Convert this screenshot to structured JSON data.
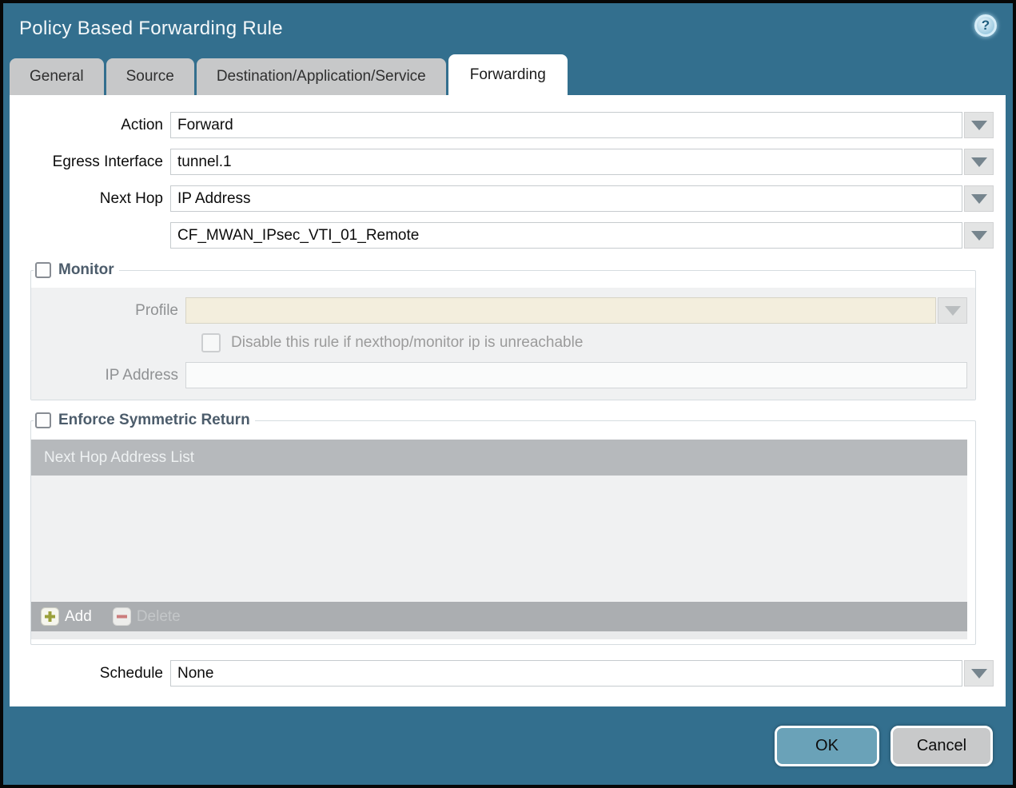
{
  "dialog": {
    "title": "Policy Based Forwarding Rule",
    "help_icon_glyph": "?"
  },
  "tabs": [
    {
      "label": "General",
      "active": false
    },
    {
      "label": "Source",
      "active": false
    },
    {
      "label": "Destination/Application/Service",
      "active": false
    },
    {
      "label": "Forwarding",
      "active": true
    }
  ],
  "form": {
    "action_label": "Action",
    "action_value": "Forward",
    "egress_label": "Egress Interface",
    "egress_value": "tunnel.1",
    "next_hop_label": "Next Hop",
    "next_hop_value": "IP Address",
    "next_hop_address_value": "CF_MWAN_IPsec_VTI_01_Remote",
    "schedule_label": "Schedule",
    "schedule_value": "None"
  },
  "monitor": {
    "legend": "Monitor",
    "checked": false,
    "profile_label": "Profile",
    "profile_value": "",
    "disable_checkbox_label": "Disable this rule if nexthop/monitor ip is unreachable",
    "disable_checkbox_checked": false,
    "ip_address_label": "IP Address",
    "ip_address_value": ""
  },
  "symmetric_return": {
    "legend": "Enforce Symmetric Return",
    "checked": false,
    "table_header": "Next Hop Address List",
    "rows": [],
    "add_label": "Add",
    "delete_label": "Delete",
    "delete_enabled": false
  },
  "footer": {
    "ok_label": "OK",
    "cancel_label": "Cancel"
  },
  "colors": {
    "chrome_teal": "#336f8e",
    "active_tab_bg": "#ffffff",
    "inactive_tab_bg": "#c7c8c9",
    "disabled_field_beige": "#f3eedd",
    "panel_gray": "#f0f1f2",
    "table_header_bg": "#b6b9bc",
    "table_footer_bg": "#abaeb1",
    "ok_button_bg": "#6aa2b8",
    "cancel_button_bg": "#c8c9ca",
    "legend_text": "#4c5c6b"
  }
}
